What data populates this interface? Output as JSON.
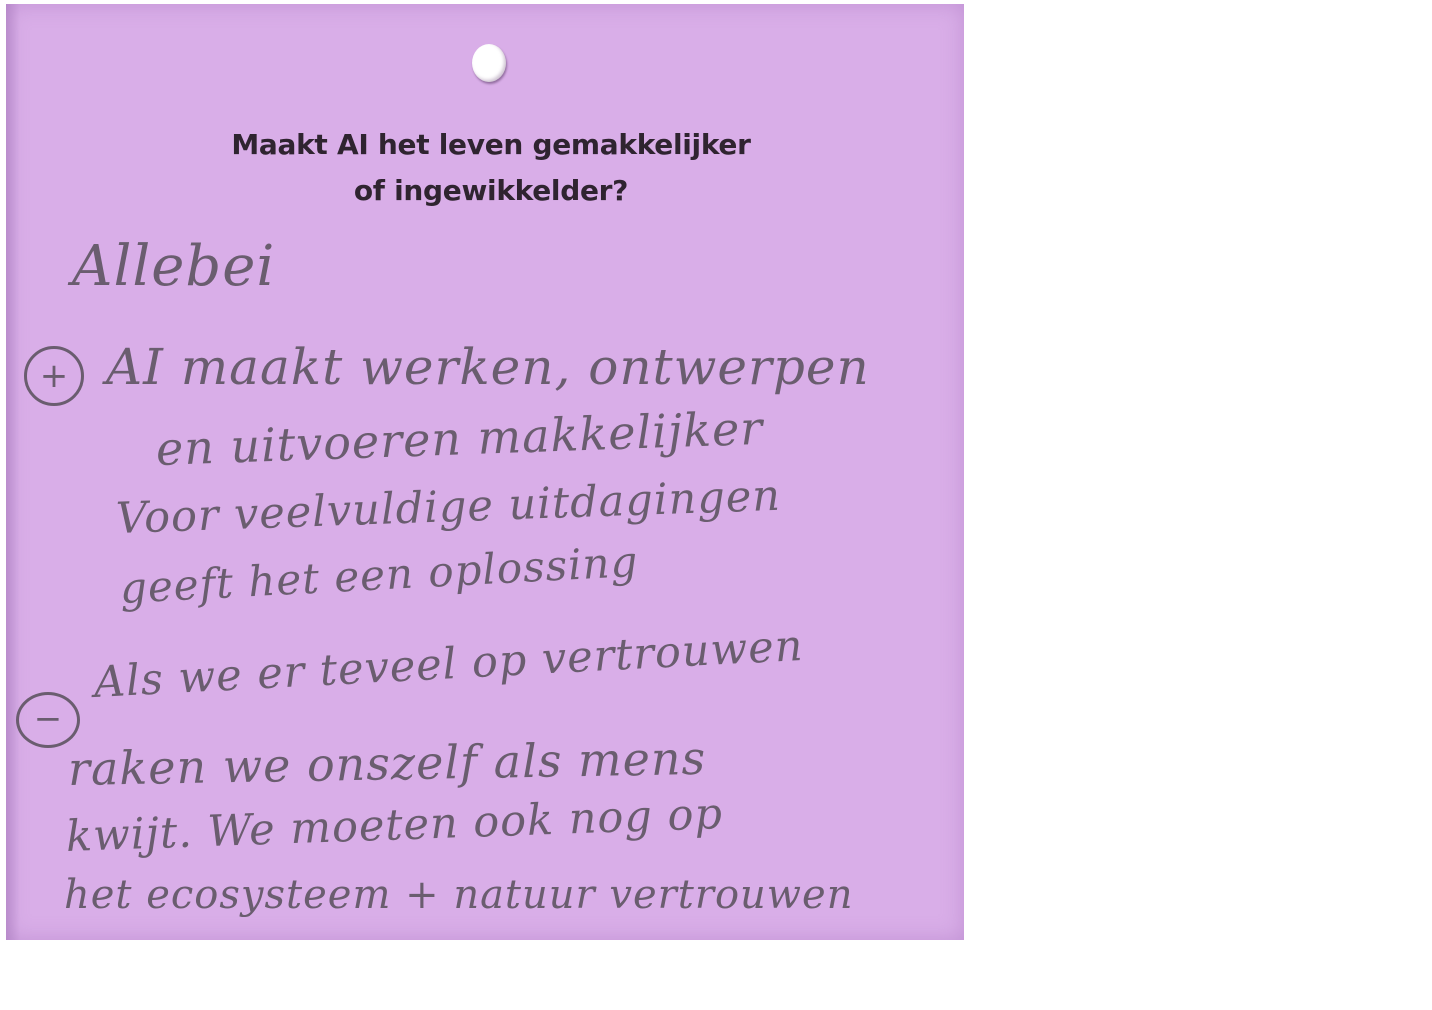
{
  "card": {
    "background_color": "#d9aee8",
    "question_lines": [
      "Maakt AI het leven gemakkelijker",
      "of ingewikkelder?"
    ],
    "answer_title": "Allebei",
    "plus_sign": "+",
    "plus_lines": [
      "AI maakt werken, ontwerpen",
      "en uitvoeren makkelijker",
      "Voor veelvuldige uitdagingen",
      "geeft het een oplossing"
    ],
    "minus_sign": "−",
    "minus_lines": [
      "Als we er teveel op vertrouwen",
      "raken we onszelf als mens",
      "kwijt. We moeten ook nog op",
      "het ecosysteem + natuur vertrouwen"
    ]
  }
}
